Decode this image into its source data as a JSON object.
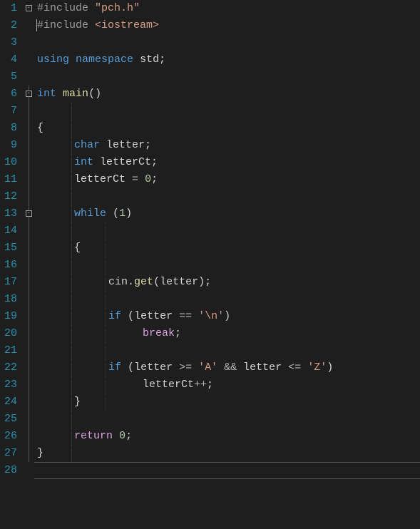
{
  "gutter": {
    "numbers": [
      "1",
      "2",
      "3",
      "4",
      "5",
      "6",
      "7",
      "8",
      "9",
      "10",
      "11",
      "12",
      "13",
      "14",
      "15",
      "16",
      "17",
      "18",
      "19",
      "20",
      "21",
      "22",
      "23",
      "24",
      "25",
      "26",
      "27",
      "28"
    ]
  },
  "fold": {
    "markers": {
      "1": "box",
      "6": "box",
      "13": "box"
    }
  },
  "code": {
    "lines": [
      {
        "tokens": [
          {
            "cls": "tok-pp",
            "t": "#include "
          },
          {
            "cls": "tok-str",
            "t": "\"pch.h\""
          }
        ]
      },
      {
        "cursorBefore": true,
        "tokens": [
          {
            "cls": "tok-pp",
            "t": "#include "
          },
          {
            "cls": "tok-inc",
            "t": "<iostream>"
          }
        ]
      },
      {
        "tokens": []
      },
      {
        "tokens": [
          {
            "cls": "tok-kw",
            "t": "using"
          },
          {
            "cls": "tok-ident",
            "t": " "
          },
          {
            "cls": "tok-kw",
            "t": "namespace"
          },
          {
            "cls": "tok-ident",
            "t": " std"
          },
          {
            "cls": "tok-punc",
            "t": ";"
          }
        ]
      },
      {
        "tokens": []
      },
      {
        "tokens": [
          {
            "cls": "tok-type",
            "t": "int"
          },
          {
            "cls": "tok-ident",
            "t": " "
          },
          {
            "cls": "tok-func",
            "t": "main"
          },
          {
            "cls": "tok-punc",
            "t": "()"
          }
        ]
      },
      {
        "guides": [
          1
        ],
        "tokens": []
      },
      {
        "guides": [
          1
        ],
        "indent": 0,
        "tokens": [
          {
            "cls": "tok-punc",
            "t": "{"
          }
        ]
      },
      {
        "guides": [
          1
        ],
        "indent": 1,
        "tokens": [
          {
            "cls": "tok-type",
            "t": "char"
          },
          {
            "cls": "tok-ident",
            "t": " letter"
          },
          {
            "cls": "tok-punc",
            "t": ";"
          }
        ]
      },
      {
        "guides": [
          1
        ],
        "indent": 1,
        "tokens": [
          {
            "cls": "tok-type",
            "t": "int"
          },
          {
            "cls": "tok-ident",
            "t": " letterCt"
          },
          {
            "cls": "tok-punc",
            "t": ";"
          }
        ]
      },
      {
        "guides": [
          1
        ],
        "indent": 1,
        "tokens": [
          {
            "cls": "tok-ident",
            "t": "letterCt "
          },
          {
            "cls": "tok-op",
            "t": "="
          },
          {
            "cls": "tok-ident",
            "t": " "
          },
          {
            "cls": "tok-num",
            "t": "0"
          },
          {
            "cls": "tok-punc",
            "t": ";"
          }
        ]
      },
      {
        "guides": [
          1
        ],
        "tokens": []
      },
      {
        "guides": [
          1
        ],
        "indent": 1,
        "tokens": [
          {
            "cls": "tok-kw",
            "t": "while"
          },
          {
            "cls": "tok-ident",
            "t": " "
          },
          {
            "cls": "tok-punc",
            "t": "("
          },
          {
            "cls": "tok-num",
            "t": "1"
          },
          {
            "cls": "tok-punc",
            "t": ")"
          }
        ]
      },
      {
        "guides": [
          1,
          2
        ],
        "tokens": []
      },
      {
        "guides": [
          1,
          2
        ],
        "indent": 1,
        "tokens": [
          {
            "cls": "tok-punc",
            "t": "{"
          }
        ]
      },
      {
        "guides": [
          1,
          2
        ],
        "tokens": []
      },
      {
        "guides": [
          1,
          2
        ],
        "indent": 2,
        "tokens": [
          {
            "cls": "tok-ident",
            "t": "cin"
          },
          {
            "cls": "tok-punc",
            "t": "."
          },
          {
            "cls": "tok-func",
            "t": "get"
          },
          {
            "cls": "tok-punc",
            "t": "("
          },
          {
            "cls": "tok-ident",
            "t": "letter"
          },
          {
            "cls": "tok-punc",
            "t": ");"
          }
        ]
      },
      {
        "guides": [
          1,
          2
        ],
        "tokens": []
      },
      {
        "guides": [
          1,
          2
        ],
        "indent": 2,
        "tokens": [
          {
            "cls": "tok-kw",
            "t": "if"
          },
          {
            "cls": "tok-ident",
            "t": " "
          },
          {
            "cls": "tok-punc",
            "t": "("
          },
          {
            "cls": "tok-ident",
            "t": "letter "
          },
          {
            "cls": "tok-op",
            "t": "=="
          },
          {
            "cls": "tok-ident",
            "t": " "
          },
          {
            "cls": "tok-char",
            "t": "'\\n'"
          },
          {
            "cls": "tok-punc",
            "t": ")"
          }
        ]
      },
      {
        "guides": [
          1,
          2
        ],
        "indent": 3,
        "tokens": [
          {
            "cls": "tok-lit",
            "t": "break"
          },
          {
            "cls": "tok-punc",
            "t": ";"
          }
        ]
      },
      {
        "guides": [
          1,
          2
        ],
        "tokens": []
      },
      {
        "guides": [
          1,
          2
        ],
        "indent": 2,
        "tokens": [
          {
            "cls": "tok-kw",
            "t": "if"
          },
          {
            "cls": "tok-ident",
            "t": " "
          },
          {
            "cls": "tok-punc",
            "t": "("
          },
          {
            "cls": "tok-ident",
            "t": "letter "
          },
          {
            "cls": "tok-op",
            "t": ">="
          },
          {
            "cls": "tok-ident",
            "t": " "
          },
          {
            "cls": "tok-char",
            "t": "'A'"
          },
          {
            "cls": "tok-ident",
            "t": " "
          },
          {
            "cls": "tok-op",
            "t": "&&"
          },
          {
            "cls": "tok-ident",
            "t": " letter "
          },
          {
            "cls": "tok-op",
            "t": "<="
          },
          {
            "cls": "tok-ident",
            "t": " "
          },
          {
            "cls": "tok-char",
            "t": "'Z'"
          },
          {
            "cls": "tok-punc",
            "t": ")"
          }
        ]
      },
      {
        "guides": [
          1,
          2
        ],
        "indent": 3,
        "tokens": [
          {
            "cls": "tok-ident",
            "t": "letterCt"
          },
          {
            "cls": "tok-op",
            "t": "++"
          },
          {
            "cls": "tok-punc",
            "t": ";"
          }
        ]
      },
      {
        "guides": [
          1,
          2
        ],
        "indent": 1,
        "tokens": [
          {
            "cls": "tok-punc",
            "t": "}"
          }
        ]
      },
      {
        "guides": [
          1
        ],
        "tokens": []
      },
      {
        "guides": [
          1
        ],
        "indent": 1,
        "tokens": [
          {
            "cls": "tok-lit",
            "t": "return"
          },
          {
            "cls": "tok-ident",
            "t": " "
          },
          {
            "cls": "tok-num",
            "t": "0"
          },
          {
            "cls": "tok-punc",
            "t": ";"
          }
        ]
      },
      {
        "guides": [
          1
        ],
        "indent": 0,
        "tokens": [
          {
            "cls": "tok-punc",
            "t": "}"
          }
        ]
      },
      {
        "cursorLine": true,
        "tokens": []
      }
    ]
  },
  "indent": {
    "width": 48,
    "base": 4
  }
}
